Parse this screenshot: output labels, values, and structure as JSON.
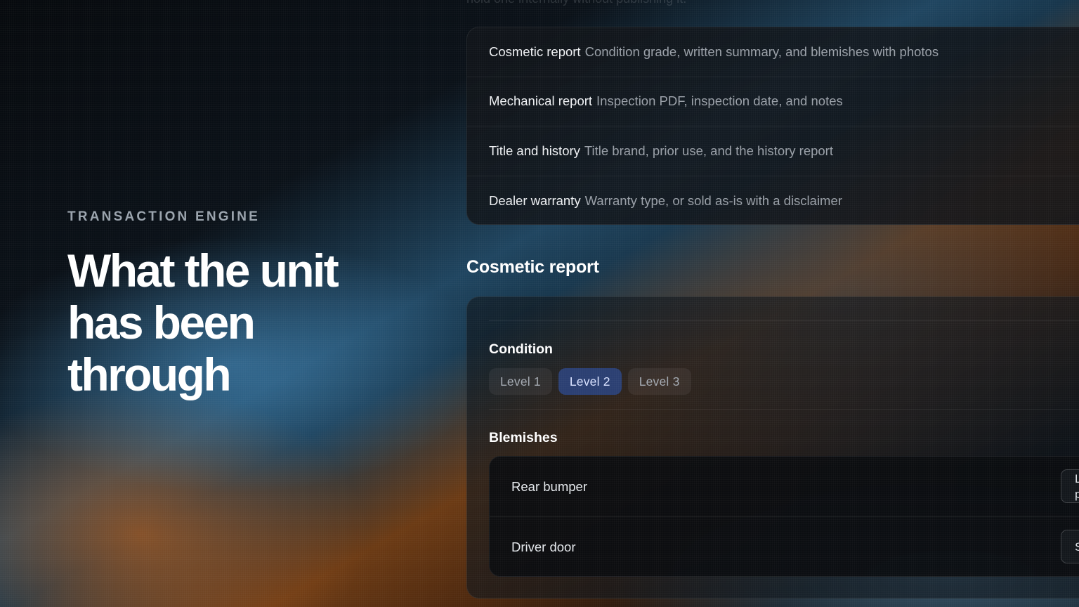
{
  "hero": {
    "eyebrow": "TRANSACTION ENGINE",
    "headline_lines": [
      "What the unit",
      "has been",
      "through"
    ]
  },
  "top_faded_text": "hold one internally without publishing it.",
  "sections": [
    {
      "title": "Cosmetic report",
      "desc": "Condition grade, written summary, and blemishes with photos"
    },
    {
      "title": "Mechanical report",
      "desc": "Inspection PDF, inspection date, and notes"
    },
    {
      "title": "Title and history",
      "desc": "Title brand, prior use, and the history report"
    },
    {
      "title": "Dealer warranty",
      "desc": "Warranty type, or sold as-is with a disclaimer"
    }
  ],
  "cosmetic": {
    "heading": "Cosmetic report",
    "condition_label": "Condition",
    "levels": [
      "Level 1",
      "Level 2",
      "Level 3"
    ],
    "selected_level": "Level 2",
    "blemishes_label": "Blemishes",
    "blemishes": [
      {
        "name": "Rear bumper",
        "control_text": "L\np"
      },
      {
        "name": "Driver door",
        "control_text": "S"
      }
    ]
  },
  "colors": {
    "accent_pill": "#2b3f72",
    "accent_pill_text": "#d9e2ff"
  }
}
